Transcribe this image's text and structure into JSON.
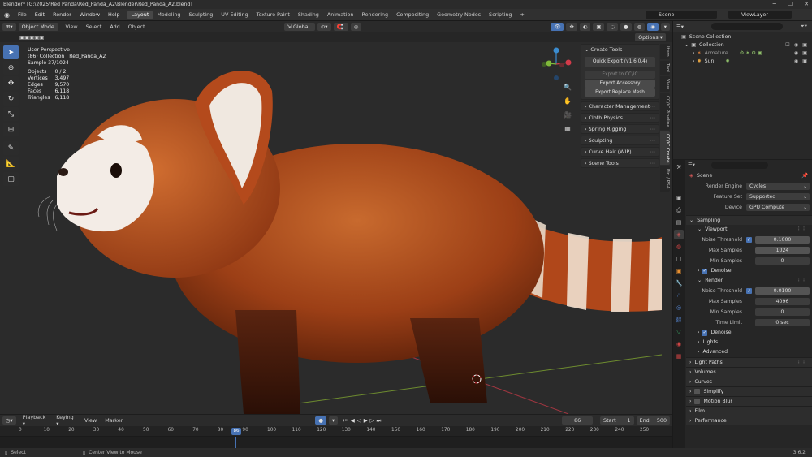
{
  "title": "Blender* [G:\\2025\\Red Panda\\Red_Panda_A2\\Blender\\Red_Panda_A2.blend]",
  "menu": [
    "File",
    "Edit",
    "Render",
    "Window",
    "Help"
  ],
  "workspaces": [
    "Layout",
    "Modeling",
    "Sculpting",
    "UV Editing",
    "Texture Paint",
    "Shading",
    "Animation",
    "Rendering",
    "Compositing",
    "Geometry Nodes",
    "Scripting"
  ],
  "active_workspace": "Layout",
  "scene_name": "Scene",
  "view_layer": "ViewLayer",
  "header": {
    "mode": "Object Mode",
    "view": "View",
    "select": "Select",
    "add": "Add",
    "object": "Object",
    "transform": "Global",
    "options": "Options"
  },
  "viewport": {
    "perspective": "User Perspective",
    "collection_line": "(86) Collection | Red_Panda_A2",
    "sample": "Sample 37/1024",
    "stats": [
      {
        "label": "Objects",
        "value": "0 / 2"
      },
      {
        "label": "Vertices",
        "value": "3,497"
      },
      {
        "label": "Edges",
        "value": "9,570"
      },
      {
        "label": "Faces",
        "value": "6,118"
      },
      {
        "label": "Triangles",
        "value": "6,118"
      }
    ]
  },
  "npanel": {
    "create_tools": "Create Tools",
    "quick_export": "Quick Export  (v1.6.0.4)",
    "export_cc": "Export to CC/iC",
    "export_accessory": "Export Accessory",
    "export_replace": "Export Replace Mesh",
    "sections": [
      "Character Management",
      "Cloth Physics",
      "Spring Rigging",
      "Sculpting",
      "Curve Hair (WIP)",
      "Scene Tools"
    ]
  },
  "side_tabs": [
    "Item",
    "Tool",
    "View",
    "CC/iC Pipeline",
    "CC/iC Create",
    "Pin / PSA"
  ],
  "timeline": {
    "playback": "Playback",
    "keying": "Keying",
    "view": "View",
    "marker": "Marker",
    "current_frame": "86",
    "start_label": "Start",
    "start": "1",
    "end_label": "End",
    "end": "500",
    "ticks": [
      "0",
      "10",
      "20",
      "30",
      "40",
      "50",
      "60",
      "70",
      "80",
      "90",
      "100",
      "110",
      "120",
      "130",
      "140",
      "150",
      "160",
      "170",
      "180",
      "190",
      "200",
      "210",
      "220",
      "230",
      "240",
      "250"
    ],
    "playhead": "86"
  },
  "statusbar": {
    "select": "Select",
    "center": "Center View to Mouse",
    "version": "3.6.2"
  },
  "outliner": {
    "root": "Scene Collection",
    "items": [
      {
        "name": "Collection",
        "indent": 1
      },
      {
        "name": "Armature",
        "indent": 2
      },
      {
        "name": "Sun",
        "indent": 2
      }
    ]
  },
  "properties": {
    "scene_label": "Scene",
    "render_engine_label": "Render Engine",
    "render_engine": "Cycles",
    "feature_set_label": "Feature Set",
    "feature_set": "Supported",
    "device_label": "Device",
    "device": "GPU Compute",
    "sampling": "Sampling",
    "viewport_label": "Viewport",
    "noise_threshold_label": "Noise Threshold",
    "vp_noise": "0.1000",
    "max_samples_label": "Max Samples",
    "vp_max": "1024",
    "min_samples_label": "Min Samples",
    "vp_min": "0",
    "denoise_label": "Denoise",
    "render_label": "Render",
    "r_noise": "0.0100",
    "r_max": "4096",
    "r_min": "0",
    "time_limit_label": "Time Limit",
    "time_limit": "0 sec",
    "lights": "Lights",
    "advanced": "Advanced",
    "sections": [
      "Light Paths",
      "Volumes",
      "Curves",
      "Simplify",
      "Motion Blur",
      "Film",
      "Performance"
    ]
  },
  "colors": {
    "accent": "#4772b3",
    "fur": "#b5501f",
    "bg": "#1d1d1d"
  }
}
